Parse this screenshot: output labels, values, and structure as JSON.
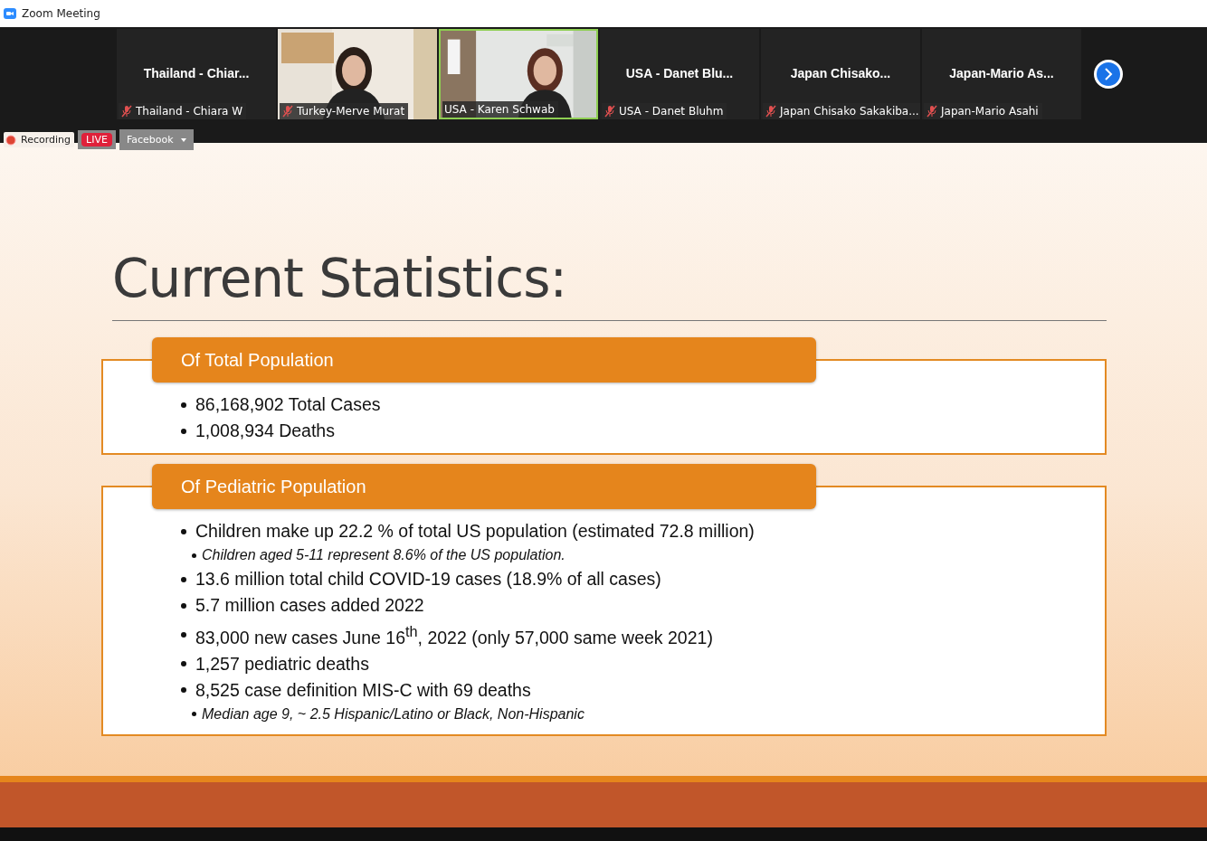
{
  "window": {
    "title": "Zoom Meeting"
  },
  "participants": [
    {
      "kind": "name",
      "display_name": "Thailand  -  Chiar...",
      "label": "Thailand - Chiara W",
      "muted": true,
      "speaking": false
    },
    {
      "kind": "video",
      "label": "Turkey-Merve Murat",
      "muted": true,
      "speaking": false
    },
    {
      "kind": "video",
      "label": "USA - Karen Schwab",
      "muted": false,
      "speaking": true
    },
    {
      "kind": "name",
      "display_name": "USA  -  Danet Blu...",
      "label": "USA - Danet Bluhm",
      "muted": true,
      "speaking": false
    },
    {
      "kind": "name",
      "display_name": "Japan   Chisako...",
      "label": "Japan  Chisako Sakakiba...",
      "muted": true,
      "speaking": false
    },
    {
      "kind": "name",
      "display_name": "Japan-Mario  As...",
      "label": "Japan-Mario Asahi",
      "muted": true,
      "speaking": false
    }
  ],
  "recording": {
    "label": "Recording",
    "live_badge": "LIVE",
    "stream_target": "Facebook"
  },
  "slide": {
    "title": "Current Statistics:",
    "sections": [
      {
        "header": "Of Total Population",
        "bullets": [
          {
            "kind": "main",
            "text": "86,168,902 Total Cases"
          },
          {
            "kind": "main",
            "text": "1,008,934 Deaths"
          }
        ]
      },
      {
        "header": "Of Pediatric Population",
        "bullets": [
          {
            "kind": "main",
            "text": "Children make up 22.2 % of total US population (estimated 72.8 million)"
          },
          {
            "kind": "sub",
            "text": "Children aged 5-11 represent 8.6% of the US population."
          },
          {
            "kind": "main",
            "text": "13.6 million total child COVID-19 cases (18.9% of all cases)"
          },
          {
            "kind": "main",
            "text": "5.7 million cases added 2022"
          },
          {
            "kind": "main",
            "text": "83,000 new cases June 16$^{th}$, 2022 (only 57,000 same week 2021)"
          },
          {
            "kind": "main",
            "text": "1,257 pediatric deaths"
          },
          {
            "kind": "main",
            "text": "8,525 case definition MIS-C with 69 deaths"
          },
          {
            "kind": "sub",
            "text": "Median age 9, ~ 2.5 Hispanic/Latino or Black, Non-Hispanic"
          }
        ]
      }
    ]
  }
}
